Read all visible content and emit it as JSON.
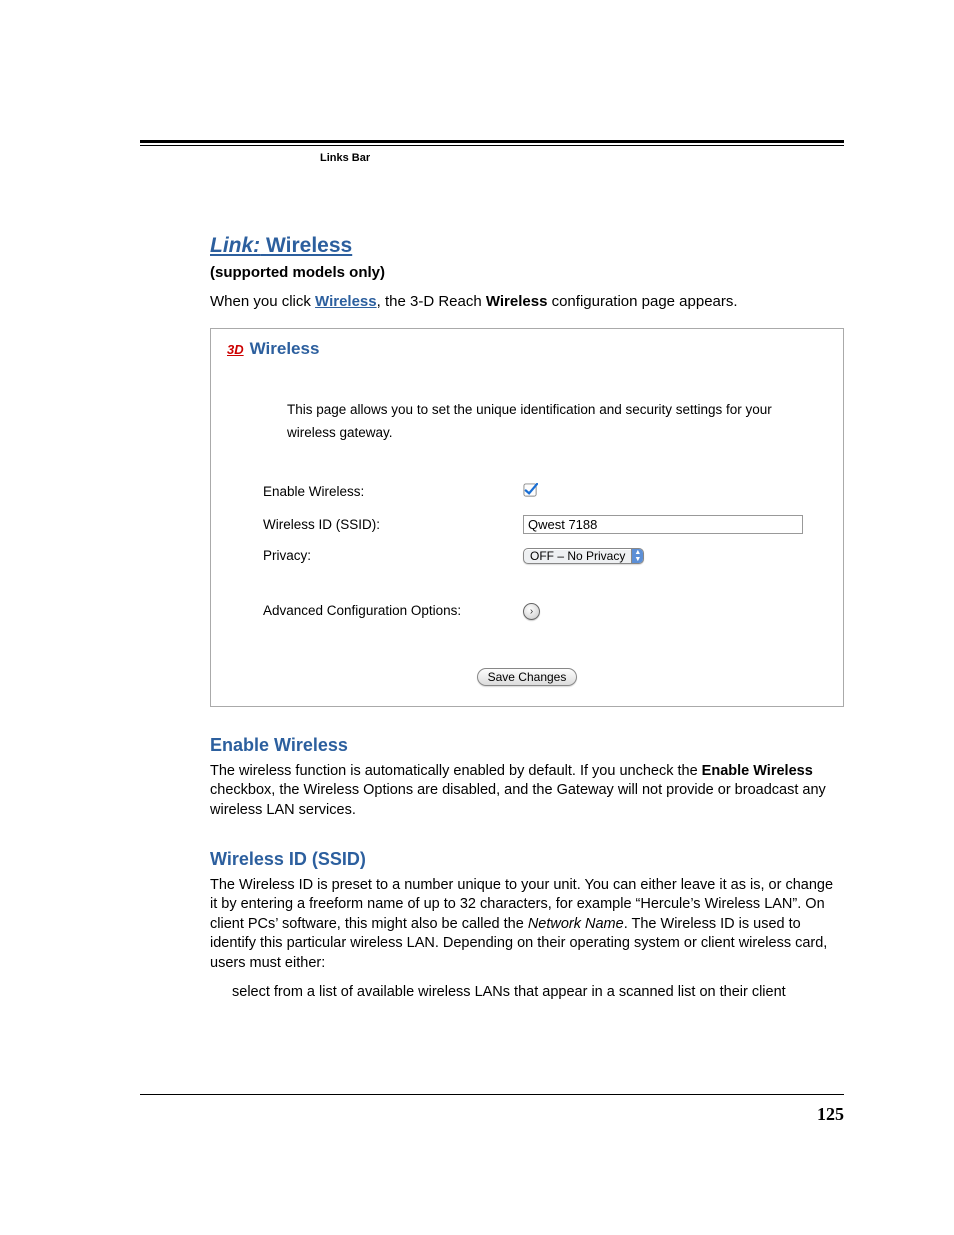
{
  "header": {
    "section_label": "Links Bar"
  },
  "title": {
    "prefix": "Link:",
    "main": "Wireless",
    "subtitle": "(supported models only)"
  },
  "intro": {
    "part1": "When you click ",
    "link_text": "Wireless",
    "part2": ", the 3-D Reach ",
    "bold": "Wireless",
    "part3": " configuration page appears."
  },
  "screenshot": {
    "brand_logo": "3D",
    "brand_text": "Wireless",
    "description": "This page allows you to set the unique identification and security settings for your wireless gateway.",
    "fields": {
      "enable_label": "Enable Wireless:",
      "enable_checked": true,
      "ssid_label": "Wireless ID (SSID):",
      "ssid_value": "Qwest 7188",
      "privacy_label": "Privacy:",
      "privacy_value": "OFF – No Privacy",
      "adv_label": "Advanced Configuration Options:"
    },
    "save_button": "Save Changes"
  },
  "sections": {
    "enable": {
      "heading": "Enable Wireless",
      "text_part1": "The wireless function is automatically enabled by default. If you uncheck the ",
      "text_bold": "Enable Wireless",
      "text_part2": " checkbox, the Wireless Options are disabled, and the Gateway will not provide or broadcast any wireless LAN services."
    },
    "ssid": {
      "heading": "Wireless ID (SSID)",
      "text_part1": "The Wireless ID is preset to a number unique to your unit. You can either leave it as is, or change it by entering a freeform name of up to 32 characters, for example “Hercule’s Wireless LAN”. On client PCs’ software, this might also be called the ",
      "text_italic": "Network Name",
      "text_part2": ". The Wireless ID is used to identify this particular wireless LAN. Depending on their operating system or client wireless card, users must either:",
      "bullet1": "select from a list of available wireless LANs that appear in a scanned list on their client"
    }
  },
  "page_number": "125"
}
